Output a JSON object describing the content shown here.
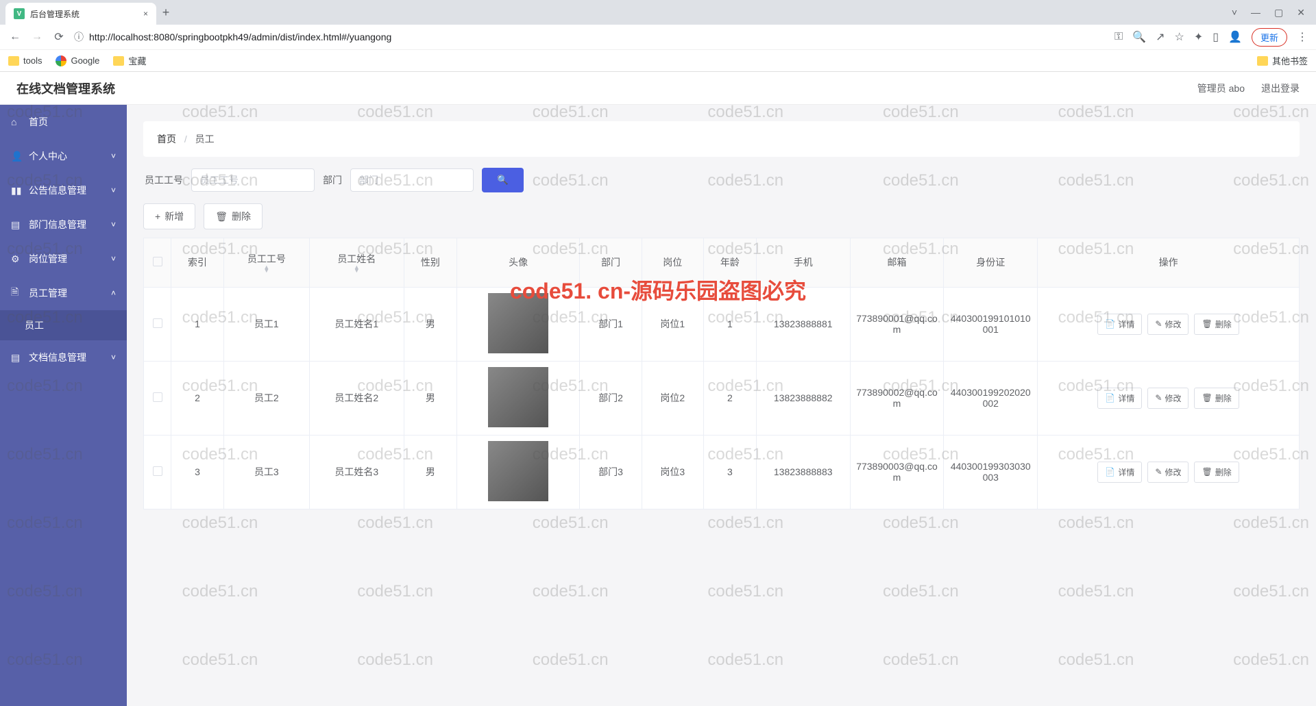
{
  "browser": {
    "tab_title": "后台管理系统",
    "url": "http://localhost:8080/springbootpkh49/admin/dist/index.html#/yuangong",
    "update_btn": "更新",
    "bookmarks": {
      "tools": "tools",
      "google": "Google",
      "baozang": "宝藏",
      "other": "其他书签"
    }
  },
  "header": {
    "app_title": "在线文档管理系统",
    "admin_label": "管理员 abo",
    "logout_label": "退出登录"
  },
  "sidebar": {
    "items": [
      {
        "icon": "⌂",
        "label": "首页",
        "arrow": ""
      },
      {
        "icon": "👤",
        "label": "个人中心",
        "arrow": "˅"
      },
      {
        "icon": "▮▮",
        "label": "公告信息管理",
        "arrow": "˅"
      },
      {
        "icon": "▤",
        "label": "部门信息管理",
        "arrow": "˅"
      },
      {
        "icon": "⚙",
        "label": "岗位管理",
        "arrow": "˅"
      },
      {
        "icon": "🗎",
        "label": "员工管理",
        "arrow": "˄"
      },
      {
        "icon": "",
        "label": "员工",
        "arrow": "",
        "sub": true
      },
      {
        "icon": "▤",
        "label": "文档信息管理",
        "arrow": "˅"
      }
    ]
  },
  "breadcrumb": {
    "home": "首页",
    "current": "员工"
  },
  "search": {
    "gonghao_label": "员工工号",
    "gonghao_placeholder": "员工工号",
    "bumen_label": "部门",
    "bumen_placeholder": "部门"
  },
  "actions": {
    "add": "新增",
    "delete": "删除"
  },
  "table": {
    "columns": {
      "index": "索引",
      "gonghao": "员工工号",
      "xingming": "员工姓名",
      "xingbie": "性别",
      "avatar": "头像",
      "bumen": "部门",
      "gangwei": "岗位",
      "nianling": "年龄",
      "shouji": "手机",
      "email": "邮箱",
      "shenfenzheng": "身份证",
      "action": "操作"
    },
    "row_actions": {
      "detail": "详情",
      "edit": "修改",
      "delete": "删除"
    },
    "rows": [
      {
        "index": "1",
        "gonghao": "员工1",
        "xingming": "员工姓名1",
        "xingbie": "男",
        "bumen": "部门1",
        "gangwei": "岗位1",
        "nianling": "1",
        "shouji": "13823888881",
        "email": "773890001@qq.com",
        "shenfenzheng": "440300199101010001"
      },
      {
        "index": "2",
        "gonghao": "员工2",
        "xingming": "员工姓名2",
        "xingbie": "男",
        "bumen": "部门2",
        "gangwei": "岗位2",
        "nianling": "2",
        "shouji": "13823888882",
        "email": "773890002@qq.com",
        "shenfenzheng": "440300199202020002"
      },
      {
        "index": "3",
        "gonghao": "员工3",
        "xingming": "员工姓名3",
        "xingbie": "男",
        "bumen": "部门3",
        "gangwei": "岗位3",
        "nianling": "3",
        "shouji": "13823888883",
        "email": "773890003@qq.com",
        "shenfenzheng": "440300199303030003"
      }
    ]
  },
  "watermark": "code51. cn-源码乐园盗图必究",
  "bg_watermark": "code51.cn"
}
